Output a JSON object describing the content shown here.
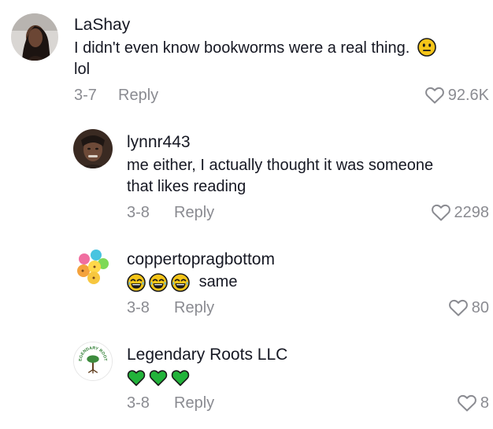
{
  "comments": [
    {
      "username": "LaShay",
      "text_line1": "I didn't even know bookworms were a real thing.",
      "text_line2": "lol",
      "date": "3-7",
      "reply_label": "Reply",
      "likes": "92.6K",
      "emoji": "neutral-face-icon"
    },
    {
      "username": "lynnr443",
      "text_line1": "me either, I actually thought it was someone",
      "text_line2": "that likes reading",
      "date": "3-8",
      "reply_label": "Reply",
      "likes": "2298"
    },
    {
      "username": "coppertopragbottom",
      "text": "same",
      "emojis": [
        "tears-of-joy-icon",
        "tears-of-joy-icon",
        "tears-of-joy-icon"
      ],
      "date": "3-8",
      "reply_label": "Reply",
      "likes": "80"
    },
    {
      "username": "Legendary Roots LLC",
      "emojis": [
        "green-heart-icon",
        "green-heart-icon",
        "green-heart-icon"
      ],
      "date": "3-8",
      "reply_label": "Reply",
      "likes": "8",
      "avatar_logo_text": "LEGENDARY ROOTS"
    }
  ],
  "colors": {
    "text": "#161823",
    "muted": "#8a8b91",
    "green_heart": "#22b33a",
    "emoji_yellow": "#f5c518"
  }
}
